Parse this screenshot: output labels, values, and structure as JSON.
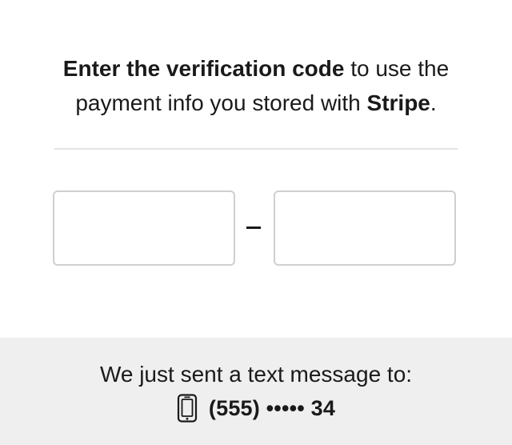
{
  "heading": {
    "bold_lead": "Enter the verification code",
    "middle_text": " to use the payment info you stored with ",
    "bold_brand": "Stripe",
    "end_punct": "."
  },
  "code_input": {
    "group1_values": [
      "",
      "",
      ""
    ],
    "group2_values": [
      "",
      "",
      ""
    ],
    "separator": "–"
  },
  "footer": {
    "message": "We just sent a text message to:",
    "phone_icon": "mobile-phone-icon",
    "phone_number": "(555) ••••• 34"
  }
}
